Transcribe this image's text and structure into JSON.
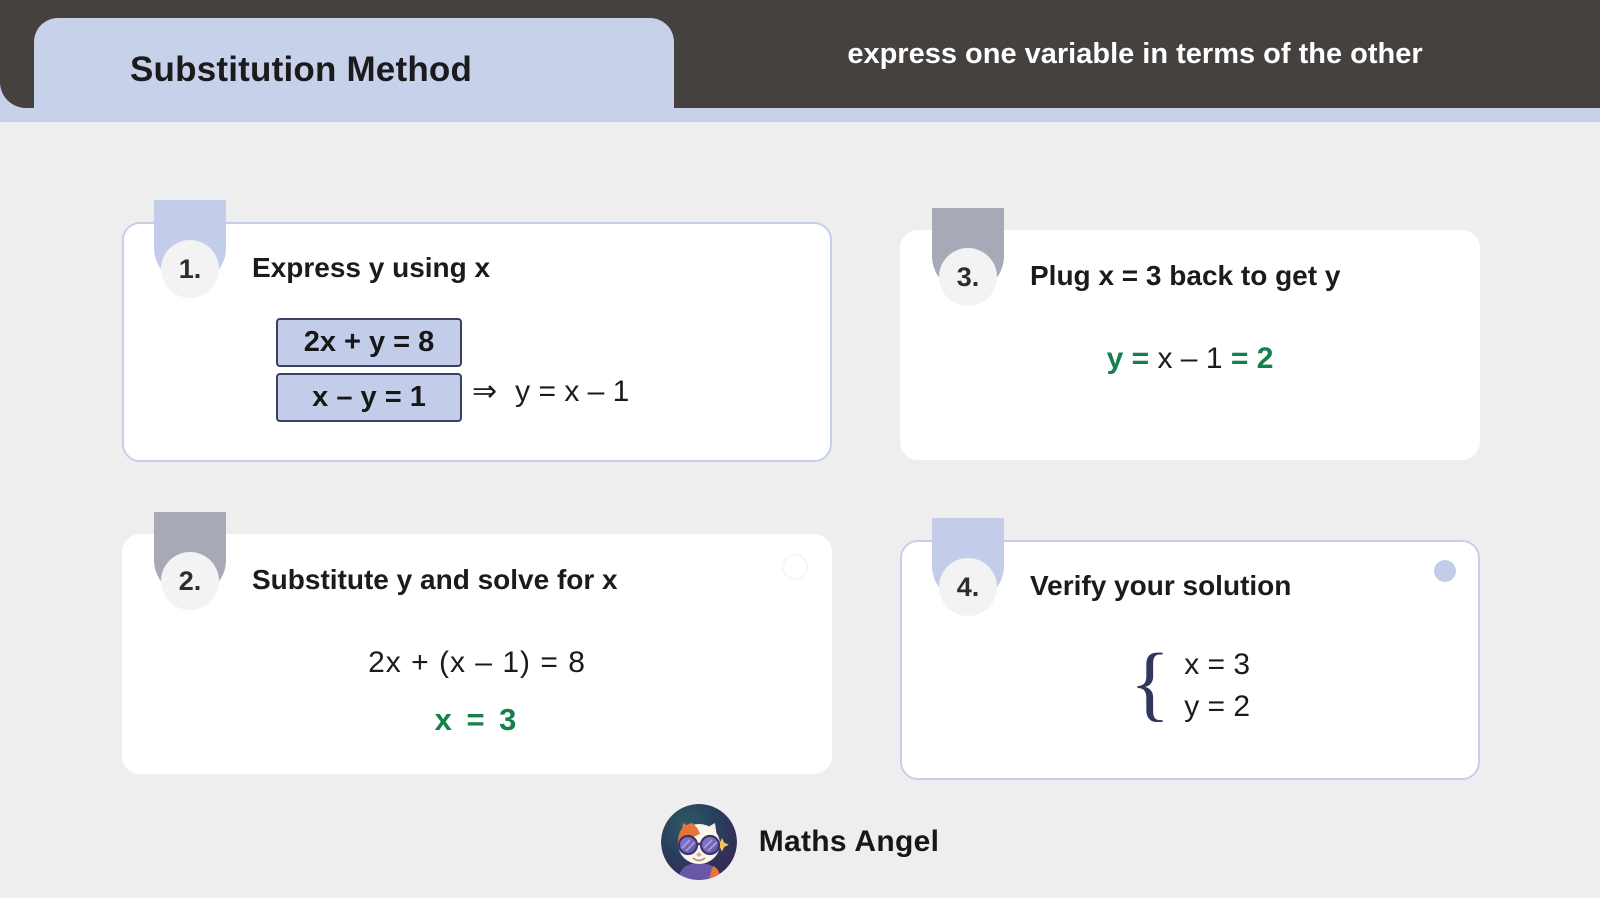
{
  "header": {
    "title": "Substitution Method",
    "subtitle": "express one variable in terms of the other",
    "tab_color": "#c8d1ea",
    "bar_color": "#44413f"
  },
  "colors": {
    "page_background": "#eeeeef",
    "card_background": "#ffffff",
    "accent_blue": "#c3cdea",
    "accent_gray": "#a7aab6",
    "answer_green": "#14804a",
    "box_border": "#3a3f63"
  },
  "cards": [
    {
      "number": "1.",
      "title": "Express y using x",
      "tab_color": "blue",
      "equation_boxes": [
        "2x + y = 8",
        "x – y = 1"
      ],
      "implies_symbol": "⇒",
      "implies_result": "y = x – 1"
    },
    {
      "number": "2.",
      "title": "Substitute y and solve for x",
      "tab_color": "gray",
      "line1": "2x + (x – 1) = 8",
      "line2": "x = 3"
    },
    {
      "number": "3.",
      "title": "Plug x = 3 back to get y",
      "tab_color": "gray",
      "result_lhs": "y =",
      "result_mid": " x – 1 ",
      "result_rhs": "= 2"
    },
    {
      "number": "4.",
      "title": "Verify your solution",
      "tab_color": "blue",
      "brace": "{",
      "solution": [
        "x = 3",
        "y = 2"
      ]
    }
  ],
  "footer": {
    "brand": "Maths Angel",
    "logo_alt": "maths-angel-cat-mascot"
  }
}
